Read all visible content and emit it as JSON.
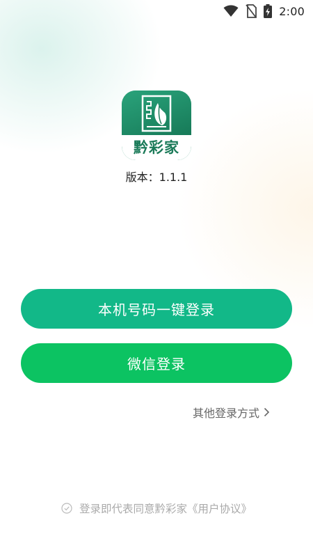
{
  "status_bar": {
    "time": "2:00",
    "icons": [
      "wifi-icon",
      "no-sim-icon",
      "battery-charging-icon"
    ]
  },
  "app": {
    "logo_text": "黔彩家",
    "version": "版本：1.1.1",
    "brand_color": "#1f8f6a"
  },
  "login": {
    "phone_button": "本机号码一键登录",
    "phone_button_color": "#12b888",
    "wechat_button": "微信登录",
    "wechat_button_color": "#0cc362",
    "other_login": "其他登录方式",
    "other_login_icon": "chevron-right-icon"
  },
  "agreement": {
    "checkbox_icon": "check-circle-icon",
    "checked": false,
    "prefix": "登录即代表同意黔彩家",
    "link": "《用户协议》"
  }
}
